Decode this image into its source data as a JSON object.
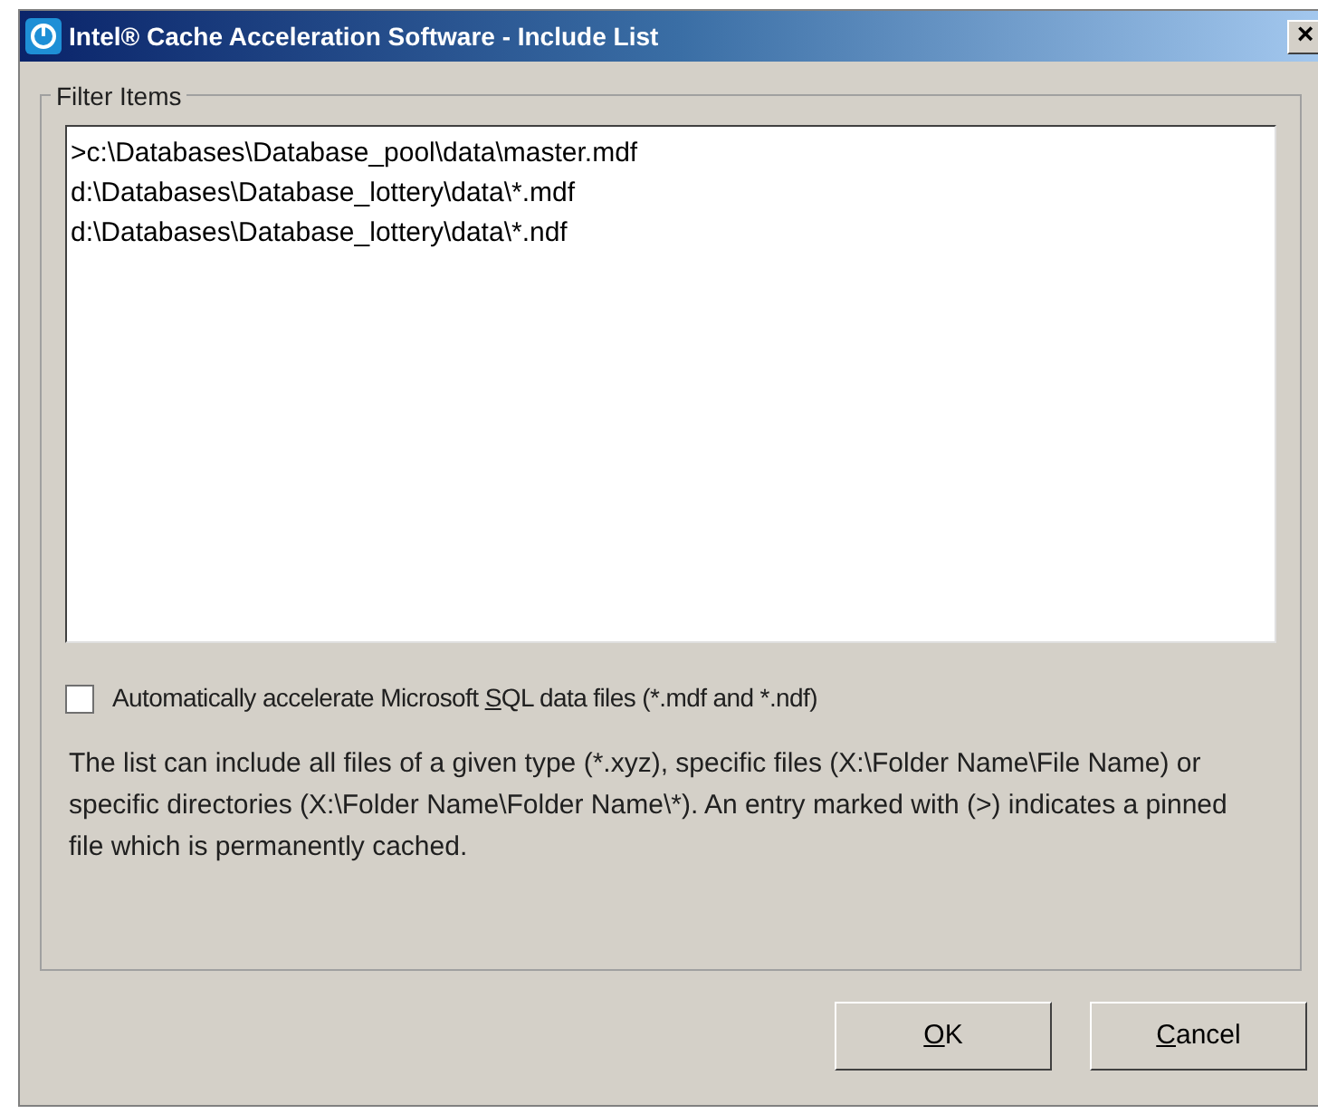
{
  "window": {
    "title": "Intel® Cache Acceleration Software - Include List",
    "close": "×"
  },
  "group": {
    "title": "Filter Items",
    "items": [
      ">c:\\Databases\\Database_pool\\data\\master.mdf",
      "d:\\Databases\\Database_lottery\\data\\*.mdf",
      "d:\\Databases\\Database_lottery\\data\\*.ndf"
    ],
    "checkbox": {
      "before": "Automatically accelerate Microsoft ",
      "accel": "S",
      "after": "QL data files (*.mdf and *.ndf)",
      "checked": false
    },
    "description": "The list can include all files of a given type (*.xyz), specific files (X:\\Folder Name\\File Name) or specific directories (X:\\Folder Name\\Folder Name\\*). An entry marked with (>) indicates a pinned file which is permanently cached."
  },
  "buttons": [
    {
      "accel": "O",
      "rest": "K"
    },
    {
      "accel": "C",
      "rest": "ancel"
    }
  ]
}
